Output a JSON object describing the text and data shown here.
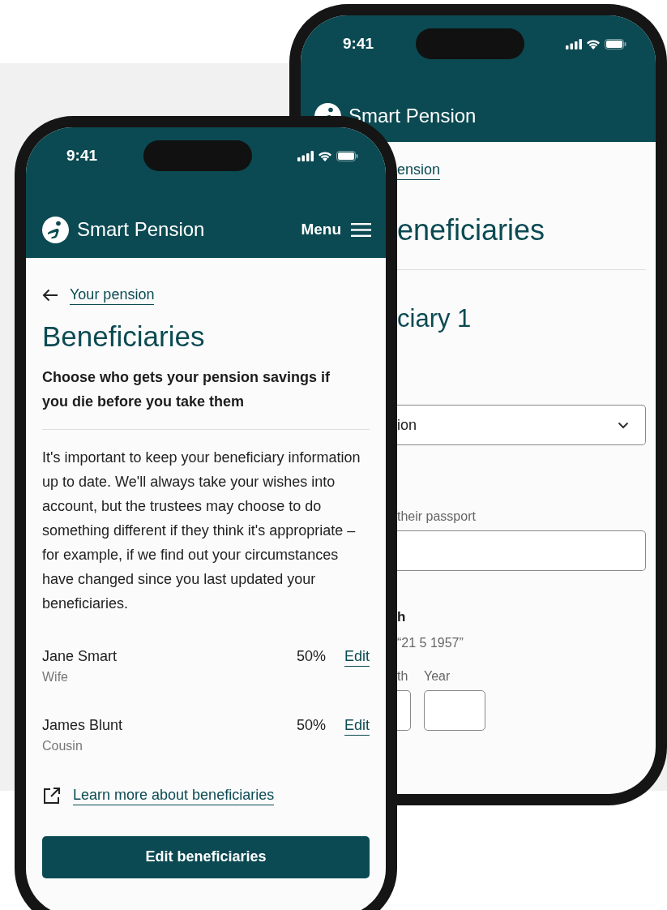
{
  "back_phone": {
    "status_time": "9:41",
    "brand": "Smart Pension",
    "back_link": "ension",
    "title": "eneficiaries",
    "section_title": "ciary 1",
    "select_value": "ion",
    "hint": "their passport",
    "dob_label": "h",
    "dob_hint": "“21 5 1957”",
    "date_labels": [
      "th",
      "Year"
    ]
  },
  "front_phone": {
    "status_time": "9:41",
    "brand": "Smart Pension",
    "menu": "Menu",
    "back_link": "Your pension",
    "title": "Beneficiaries",
    "subtitle": "Choose who gets your pension savings if you die before you take them",
    "body": "It's important to keep your beneficiary information up to date. We'll always take your wishes into account, but the trustees may choose to do something different if they think it's appropriate – for example, if we find out your circumstances have changed since you last updated your beneficiaries.",
    "beneficiaries": [
      {
        "name": "Jane Smart",
        "relation": "Wife",
        "share": "50%",
        "action": "Edit"
      },
      {
        "name": "James Blunt",
        "relation": "Cousin",
        "share": "50%",
        "action": "Edit"
      }
    ],
    "learn_more": "Learn more about beneficiaries",
    "button": "Edit beneficiaries"
  }
}
